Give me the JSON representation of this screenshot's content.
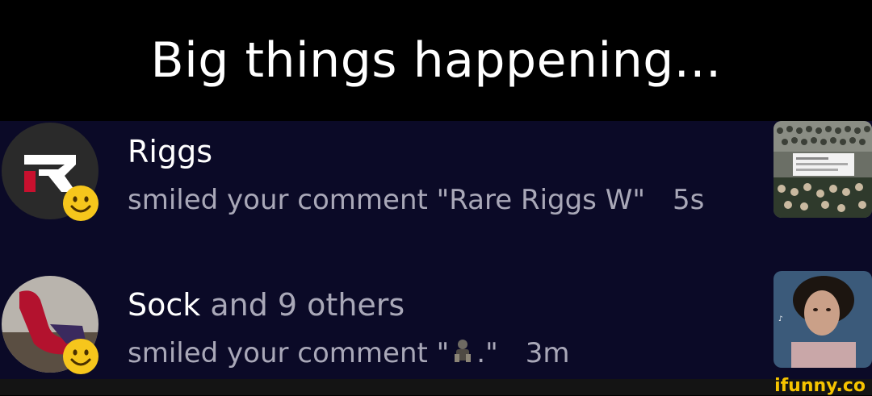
{
  "caption": "Big things happening...",
  "notifications": [
    {
      "name": "Riggs",
      "name_suffix": "",
      "action": "smiled your comment \"Rare Riggs W\"",
      "time": "5s",
      "avatar_icon": "riggs-logo-avatar",
      "badge_icon": "smiley-icon",
      "thumbnail": "crowd-photo-thumbnail"
    },
    {
      "name": "Sock",
      "name_suffix": " and 9 others",
      "action_prefix": "smiled your comment \"",
      "action_suffix": ".\"",
      "inline_emoji": "figure-emoji",
      "time": "3m",
      "avatar_icon": "sock-photo-avatar",
      "badge_icon": "smiley-icon",
      "thumbnail": "tiktok-video-thumbnail"
    }
  ],
  "watermark": "ifunny.co",
  "colors": {
    "panel": "#0b0a27",
    "muted_text": "#a9a8b8",
    "emoji_yellow": "#f6c61c",
    "watermark": "#f5c400"
  }
}
